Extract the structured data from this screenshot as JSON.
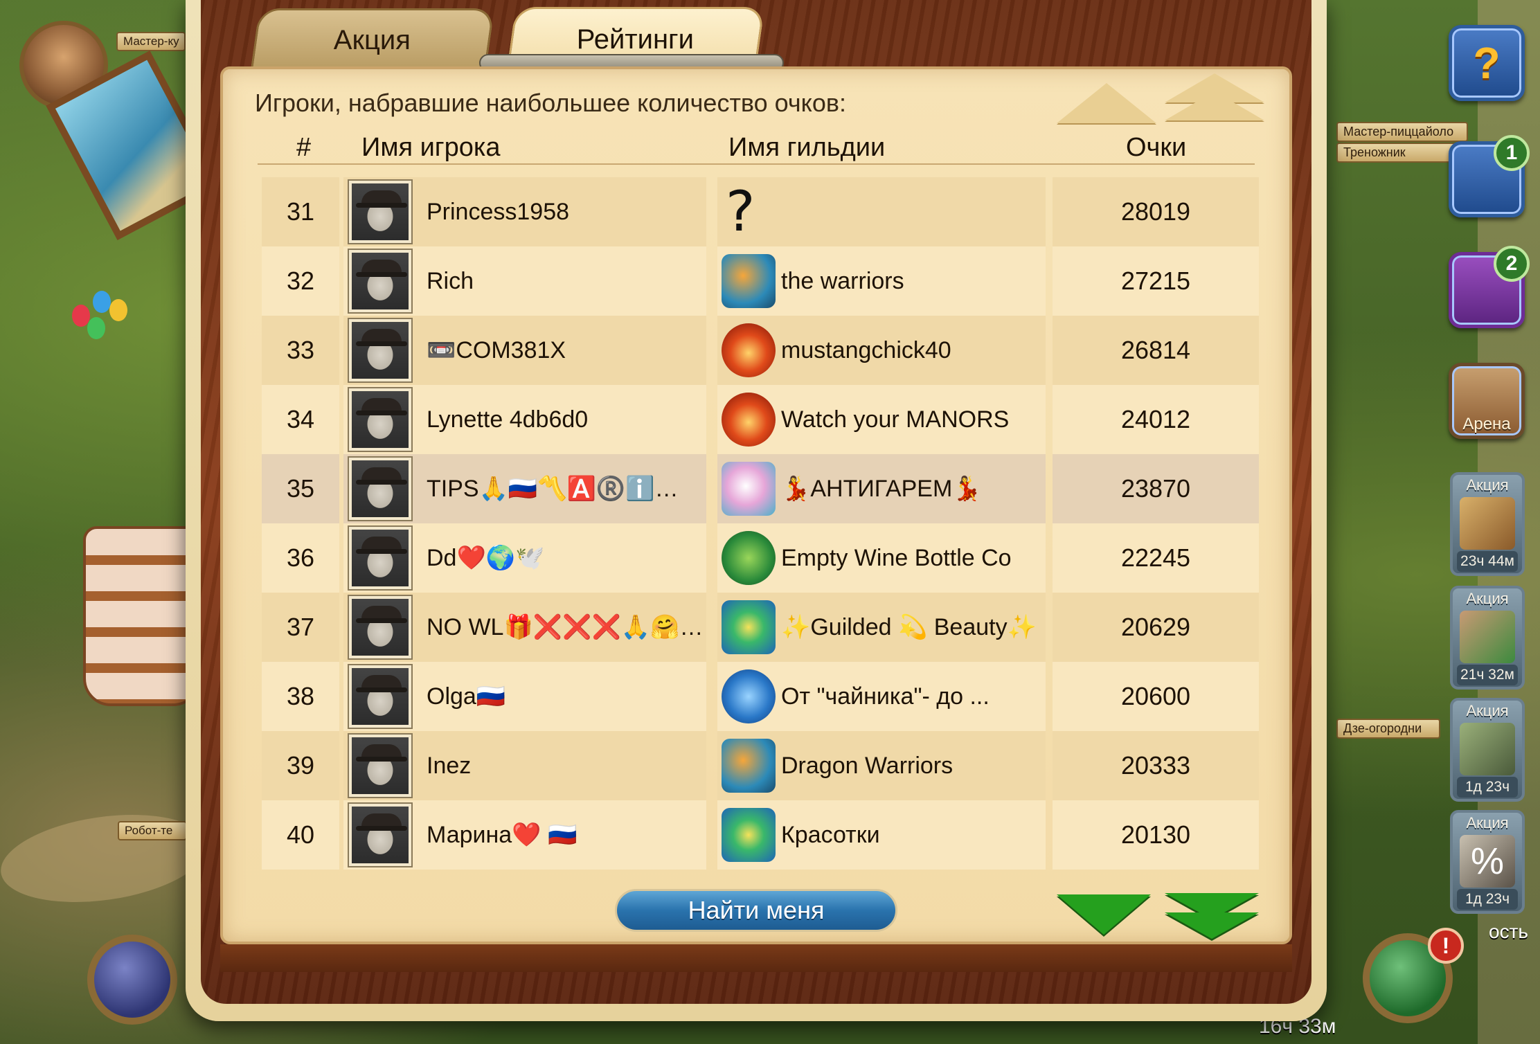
{
  "tabs": [
    {
      "label": "Акция"
    },
    {
      "label": "Рейтинги"
    }
  ],
  "subtitle": "Игроки, набравшие наибольшее количество очков:",
  "columns": {
    "rank": "#",
    "player": "Имя игрока",
    "guild": "Имя гильдии",
    "score": "Очки"
  },
  "rows": [
    {
      "rank": "31",
      "player": "Princess1958",
      "guild": "?",
      "guild_icon": "question-mark",
      "score": "28019"
    },
    {
      "rank": "32",
      "player": "Rich",
      "guild": "the warriors",
      "guild_icon": "dragon-emblem-icon",
      "score": "27215"
    },
    {
      "rank": "33",
      "player": "📼COM381X",
      "guild": "mustangchick40",
      "guild_icon": "fire-emblem-icon",
      "score": "26814"
    },
    {
      "rank": "34",
      "player": "Lynette 4db6d0",
      "guild": "Watch your MANORS",
      "guild_icon": "fire-emblem-icon",
      "score": "24012"
    },
    {
      "rank": "35",
      "player": "TIPS🙏🇷🇺〽️🅰️®️ℹ️🅰️…",
      "guild": "💃АНТИГАРЕМ💃",
      "guild_icon": "unicorn-emblem-icon",
      "score": "23870"
    },
    {
      "rank": "36",
      "player": "Dd❤️🌍🕊️",
      "guild": "Empty Wine Bottle Co",
      "guild_icon": "turtle-emblem-icon",
      "score": "22245"
    },
    {
      "rank": "37",
      "player": "NO WL🎁❌❌❌🙏🤗me…",
      "guild": "✨Guilded 💫 Beauty✨",
      "guild_icon": "butterfly-emblem-icon",
      "score": "20629"
    },
    {
      "rank": "38",
      "player": "Olga🇷🇺",
      "guild": "От \"чайника\"- до ...",
      "guild_icon": "wave-emblem-icon",
      "score": "20600"
    },
    {
      "rank": "39",
      "player": "Inez",
      "guild": "Dragon Warriors",
      "guild_icon": "dragon-emblem-icon",
      "score": "20333"
    },
    {
      "rank": "40",
      "player": "Марина❤️ 🇷🇺",
      "guild": "Красотки",
      "guild_icon": "butterfly-emblem-icon",
      "score": "20130"
    }
  ],
  "selected_rank": "35",
  "find_me_label": "Найти меня",
  "map_labels": {
    "master_top": "Мастер-ку",
    "pizza_master": "Мастер-пиццайоло",
    "tripod": "Треножник",
    "robot": "Робот-те",
    "dze": "Дзе-огородни",
    "bottom_right": "ость"
  },
  "side_panel": {
    "help_symbol": "?",
    "badge_1": "1",
    "badge_2": "2",
    "arena_label": "Арена",
    "promos": [
      {
        "title": "Акция",
        "time": "23ч 44м"
      },
      {
        "title": "Акция",
        "time": "21ч 32м"
      },
      {
        "title": "Акция",
        "time": "1д 23ч"
      },
      {
        "title": "Акция",
        "time": "1д 23ч"
      }
    ],
    "alert_symbol": "!",
    "bottom_timer": "16ч 33м"
  },
  "colors": {
    "panel_bg": "#f7e3b6",
    "row_alt": "#f0d9a8",
    "row_selected": "#e6d2b6",
    "wood": "#8a3d1b",
    "find_button": "#2a73ad",
    "arrow_down": "#25a01e"
  }
}
